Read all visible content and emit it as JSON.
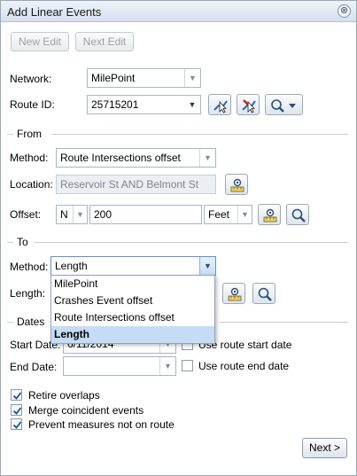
{
  "window": {
    "title": "Add Linear Events",
    "close_glyph": "⊗"
  },
  "toolbar": {
    "new_edit": "New Edit",
    "next_edit": "Next Edit"
  },
  "network": {
    "label": "Network:",
    "value": "MilePoint"
  },
  "route": {
    "label": "Route ID:",
    "value": "25715201"
  },
  "from": {
    "section_label": "From",
    "method_label": "Method:",
    "method_value": "Route Intersections offset",
    "location_label": "Location:",
    "location_value": "Reservoir St AND Belmont St",
    "offset_label": "Offset:",
    "direction_value": "N",
    "offset_value": "200",
    "units_value": "Feet"
  },
  "to": {
    "section_label": "To",
    "method_label": "Method:",
    "method_value": "Length",
    "length_label": "Length:",
    "options": [
      "MilePoint",
      "Crashes Event offset",
      "Route Intersections offset",
      "Length"
    ],
    "selected_index": 3
  },
  "dates": {
    "section_label": "Dates",
    "start_label": "Start Date:",
    "start_value": "6/11/2014",
    "end_label": "End Date:",
    "end_value": "",
    "use_start_label": "Use route start date",
    "use_end_label": "Use route end date"
  },
  "options": {
    "retire_overlaps": "Retire overlaps",
    "merge_coincident": "Merge coincident events",
    "prevent_measures": "Prevent measures not on route"
  },
  "footer": {
    "next_label": "Next >"
  }
}
